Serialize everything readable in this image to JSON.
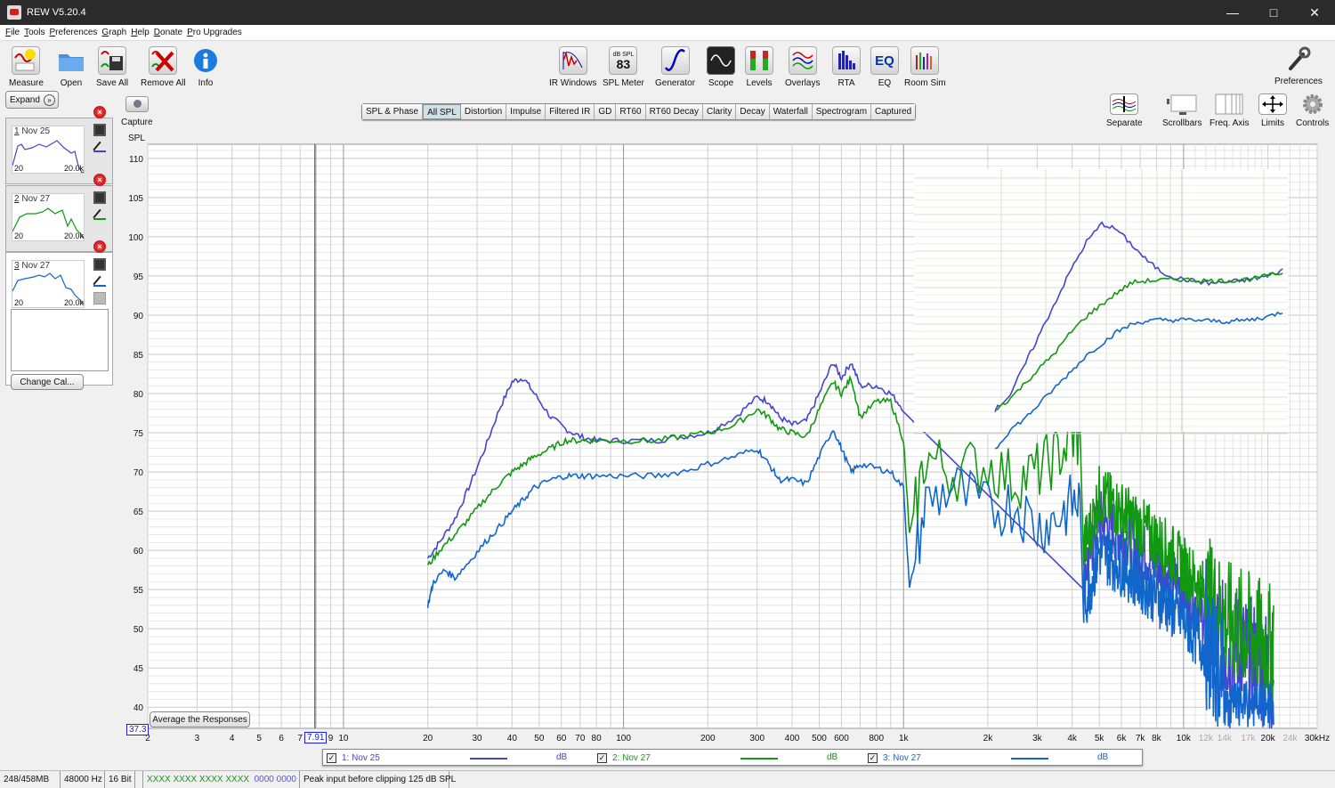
{
  "window": {
    "title": "REW V5.20.4",
    "controls": [
      "minimize",
      "maximize",
      "close"
    ]
  },
  "menu": [
    "File",
    "Tools",
    "Preferences",
    "Graph",
    "Help",
    "Donate",
    "Pro Upgrades"
  ],
  "toolbar_left": [
    {
      "id": "measure",
      "label": "Measure",
      "icon": "measure-icon"
    },
    {
      "id": "open",
      "label": "Open",
      "icon": "folder-icon"
    },
    {
      "id": "save-all",
      "label": "Save All",
      "icon": "save-all-icon"
    },
    {
      "id": "remove-all",
      "label": "Remove All",
      "icon": "remove-all-icon"
    },
    {
      "id": "info",
      "label": "Info",
      "icon": "info-icon"
    }
  ],
  "toolbar_center": [
    {
      "id": "ir-windows",
      "label": "IR Windows",
      "icon": "ir-windows-icon"
    },
    {
      "id": "spl-meter",
      "label": "SPL Meter",
      "icon": "spl-meter-icon",
      "meter_unit": "dB SPL",
      "meter_value": "83"
    },
    {
      "id": "generator",
      "label": "Generator",
      "icon": "generator-icon"
    },
    {
      "id": "scope",
      "label": "Scope",
      "icon": "scope-icon"
    },
    {
      "id": "levels",
      "label": "Levels",
      "icon": "levels-icon"
    },
    {
      "id": "overlays",
      "label": "Overlays",
      "icon": "overlays-icon"
    },
    {
      "id": "rta",
      "label": "RTA",
      "icon": "rta-icon"
    },
    {
      "id": "eq",
      "label": "EQ",
      "icon": "eq-icon",
      "glyph": "EQ"
    },
    {
      "id": "room-sim",
      "label": "Room Sim",
      "icon": "room-sim-icon"
    }
  ],
  "toolbar_right": {
    "preferences_label": "Preferences"
  },
  "graph_controls": [
    {
      "id": "separate",
      "label": "Separate"
    },
    {
      "id": "scrollbars",
      "label": "Scrollbars"
    },
    {
      "id": "freq-axis",
      "label": "Freq. Axis"
    },
    {
      "id": "limits",
      "label": "Limits"
    },
    {
      "id": "controls",
      "label": "Controls"
    }
  ],
  "capture_label": "Capture",
  "tabs": [
    {
      "label": "SPL & Phase",
      "active": false
    },
    {
      "label": "All SPL",
      "active": true
    },
    {
      "label": "Distortion",
      "active": false
    },
    {
      "label": "Impulse",
      "active": false
    },
    {
      "label": "Filtered IR",
      "active": false
    },
    {
      "label": "GD",
      "active": false
    },
    {
      "label": "RT60",
      "active": false
    },
    {
      "label": "RT60 Decay",
      "active": false
    },
    {
      "label": "Clarity",
      "active": false
    },
    {
      "label": "Decay",
      "active": false
    },
    {
      "label": "Waterfall",
      "active": false
    },
    {
      "label": "Spectrogram",
      "active": false
    },
    {
      "label": "Captured",
      "active": false
    }
  ],
  "left_panel": {
    "expand_label": "Expand",
    "measurements": [
      {
        "num": "1",
        "name": "Nov 25",
        "lo": "20",
        "hi": "20.0k",
        "color": "#4444cc"
      },
      {
        "num": "2",
        "name": "Nov 27",
        "lo": "20",
        "hi": "20.0k",
        "color": "#119911"
      },
      {
        "num": "3",
        "name": "Nov 27",
        "lo": "20",
        "hi": "20.0k",
        "color": "#1166cc"
      }
    ],
    "change_cal_label": "Change Cal..."
  },
  "average_button_label": "Average the Responses",
  "cursor": {
    "y_value": "37.3",
    "x_value": "7.91"
  },
  "legend": [
    {
      "checked": true,
      "label": "1: Nov 25",
      "unit": "dB",
      "color": "#4444cc"
    },
    {
      "checked": true,
      "label": "2: Nov 27",
      "unit": "dB",
      "color": "#119911"
    },
    {
      "checked": true,
      "label": "3: Nov 27",
      "unit": "dB",
      "color": "#1166cc"
    }
  ],
  "status": {
    "memory": "248/458MB",
    "rate": "48000 Hz",
    "bits": "16 Bit",
    "input_levels_green": "XXXX XXXX  XXXX XXXX",
    "input_levels_blue": "0000 0000",
    "peak": "Peak input before clipping 125 dB SPL"
  },
  "chart_data": {
    "type": "line",
    "title": "All SPL",
    "ylabel": "SPL",
    "xlabel": "",
    "xscale": "log",
    "xlim": [
      2,
      30000
    ],
    "ylim": [
      37.3,
      112
    ],
    "grid": true,
    "legend_position": "bottom",
    "y_ticks": [
      110,
      105,
      100,
      95,
      90,
      85,
      80,
      75,
      70,
      65,
      60,
      55,
      50,
      45,
      40
    ],
    "x_ticks": [
      {
        "v": 2,
        "t": "2"
      },
      {
        "v": 3,
        "t": "3"
      },
      {
        "v": 4,
        "t": "4"
      },
      {
        "v": 5,
        "t": "5"
      },
      {
        "v": 6,
        "t": "6"
      },
      {
        "v": 7,
        "t": "7"
      },
      {
        "v": 9,
        "t": "9"
      },
      {
        "v": 10,
        "t": "10"
      },
      {
        "v": 20,
        "t": "20"
      },
      {
        "v": 30,
        "t": "30"
      },
      {
        "v": 40,
        "t": "40"
      },
      {
        "v": 50,
        "t": "50"
      },
      {
        "v": 60,
        "t": "60"
      },
      {
        "v": 70,
        "t": "70"
      },
      {
        "v": 80,
        "t": "80"
      },
      {
        "v": 100,
        "t": "100"
      },
      {
        "v": 200,
        "t": "200"
      },
      {
        "v": 300,
        "t": "300"
      },
      {
        "v": 400,
        "t": "400"
      },
      {
        "v": 500,
        "t": "500"
      },
      {
        "v": 600,
        "t": "600"
      },
      {
        "v": 800,
        "t": "800"
      },
      {
        "v": 1000,
        "t": "1k"
      },
      {
        "v": 2000,
        "t": "2k"
      },
      {
        "v": 3000,
        "t": "3k"
      },
      {
        "v": 4000,
        "t": "4k"
      },
      {
        "v": 5000,
        "t": "5k"
      },
      {
        "v": 6000,
        "t": "6k"
      },
      {
        "v": 7000,
        "t": "7k"
      },
      {
        "v": 8000,
        "t": "8k"
      },
      {
        "v": 10000,
        "t": "10k"
      },
      {
        "v": 12000,
        "t": "12k",
        "dim": true
      },
      {
        "v": 14000,
        "t": "14k",
        "dim": true
      },
      {
        "v": 17000,
        "t": "17k",
        "dim": true
      },
      {
        "v": 20000,
        "t": "20k"
      },
      {
        "v": 24000,
        "t": "24k",
        "dim": true
      },
      {
        "v": 30000,
        "t": "30kHz"
      }
    ],
    "cursor_x": 7.91,
    "series": [
      {
        "name": "1: Nov 25",
        "color": "#4444cc",
        "x": [
          20,
          22,
          25,
          28,
          32,
          36,
          40,
          44,
          48,
          55,
          62,
          70,
          80,
          100,
          130,
          160,
          200,
          250,
          300,
          330,
          360,
          400,
          450,
          500,
          560,
          600,
          650,
          700,
          800,
          900,
          1000
        ],
        "y": [
          59,
          61,
          64,
          68,
          73,
          78,
          81.5,
          82,
          80,
          77,
          75.5,
          74.5,
          74,
          74,
          74,
          74.5,
          75,
          77,
          79.5,
          79,
          77,
          76,
          76.5,
          80,
          84,
          82,
          84,
          81,
          81,
          80,
          78
        ]
      },
      {
        "name": "2: Nov 27",
        "color": "#119911",
        "x": [
          20,
          22,
          25,
          28,
          32,
          36,
          40,
          44,
          48,
          55,
          62,
          70,
          80,
          100,
          130,
          160,
          200,
          250,
          300,
          330,
          360,
          400,
          450,
          500,
          560,
          600,
          650,
          700,
          800,
          900,
          1000,
          1050,
          1200,
          1500,
          2000,
          2500,
          3000,
          3500,
          4000,
          4300
        ],
        "y": [
          58,
          60,
          62,
          64,
          66.5,
          68.5,
          70,
          71,
          72,
          73,
          74,
          74,
          74,
          74,
          74,
          74.5,
          75,
          76,
          78,
          77,
          75.5,
          75,
          74.5,
          78,
          81.5,
          80,
          82,
          77,
          79,
          79,
          74,
          62,
          72,
          70,
          71,
          69,
          70,
          72,
          74,
          74
        ]
      },
      {
        "name": "3: Nov 27",
        "color": "#1166cc",
        "x": [
          20,
          21,
          23,
          25,
          28,
          32,
          36,
          40,
          44,
          48,
          55,
          62,
          70,
          80,
          100,
          130,
          160,
          200,
          250,
          300,
          330,
          360,
          400,
          450,
          500,
          560,
          600,
          650,
          700,
          800,
          900,
          1000,
          1050,
          1200,
          1500,
          2000,
          2500,
          3000,
          3500,
          4000,
          4300
        ],
        "y": [
          53,
          56,
          57.5,
          56.5,
          58.5,
          61,
          63,
          65,
          66.5,
          68,
          69,
          69.5,
          69.5,
          69.5,
          69.5,
          69.5,
          70,
          71,
          72,
          73,
          71,
          69,
          69,
          68.5,
          72,
          75.5,
          73,
          70,
          71,
          70.5,
          70,
          68,
          55,
          66,
          68,
          65,
          66,
          63,
          64,
          66,
          66
        ]
      }
    ],
    "inset": {
      "note": "overlaid zoomed capture of the 1 kHz-20 kHz region",
      "series": [
        {
          "name": "1: Nov 25",
          "color": "#4444cc",
          "y": [
            78,
            80,
            84,
            88,
            92,
            96,
            99.5,
            101.8,
            101,
            99,
            97,
            95.5,
            94.8,
            94.5,
            94.2,
            94.3,
            94.5,
            94.8,
            95.2,
            96
          ]
        },
        {
          "name": "2: Nov 27",
          "color": "#119911",
          "y": [
            78,
            79.5,
            81.5,
            83.5,
            85.5,
            88,
            90,
            91.5,
            93,
            94.3,
            94.5,
            94.6,
            94.7,
            94.6,
            94.5,
            94.5,
            94.6,
            94.8,
            95.2,
            95.6
          ]
        },
        {
          "name": "3: Nov 27",
          "color": "#1166cc",
          "y": [
            73,
            75.5,
            77,
            79,
            81,
            83,
            85,
            86.5,
            88,
            89,
            89.4,
            89.5,
            89.5,
            89.5,
            89.4,
            89.3,
            89.4,
            89.6,
            90,
            90.7
          ]
        }
      ]
    }
  }
}
